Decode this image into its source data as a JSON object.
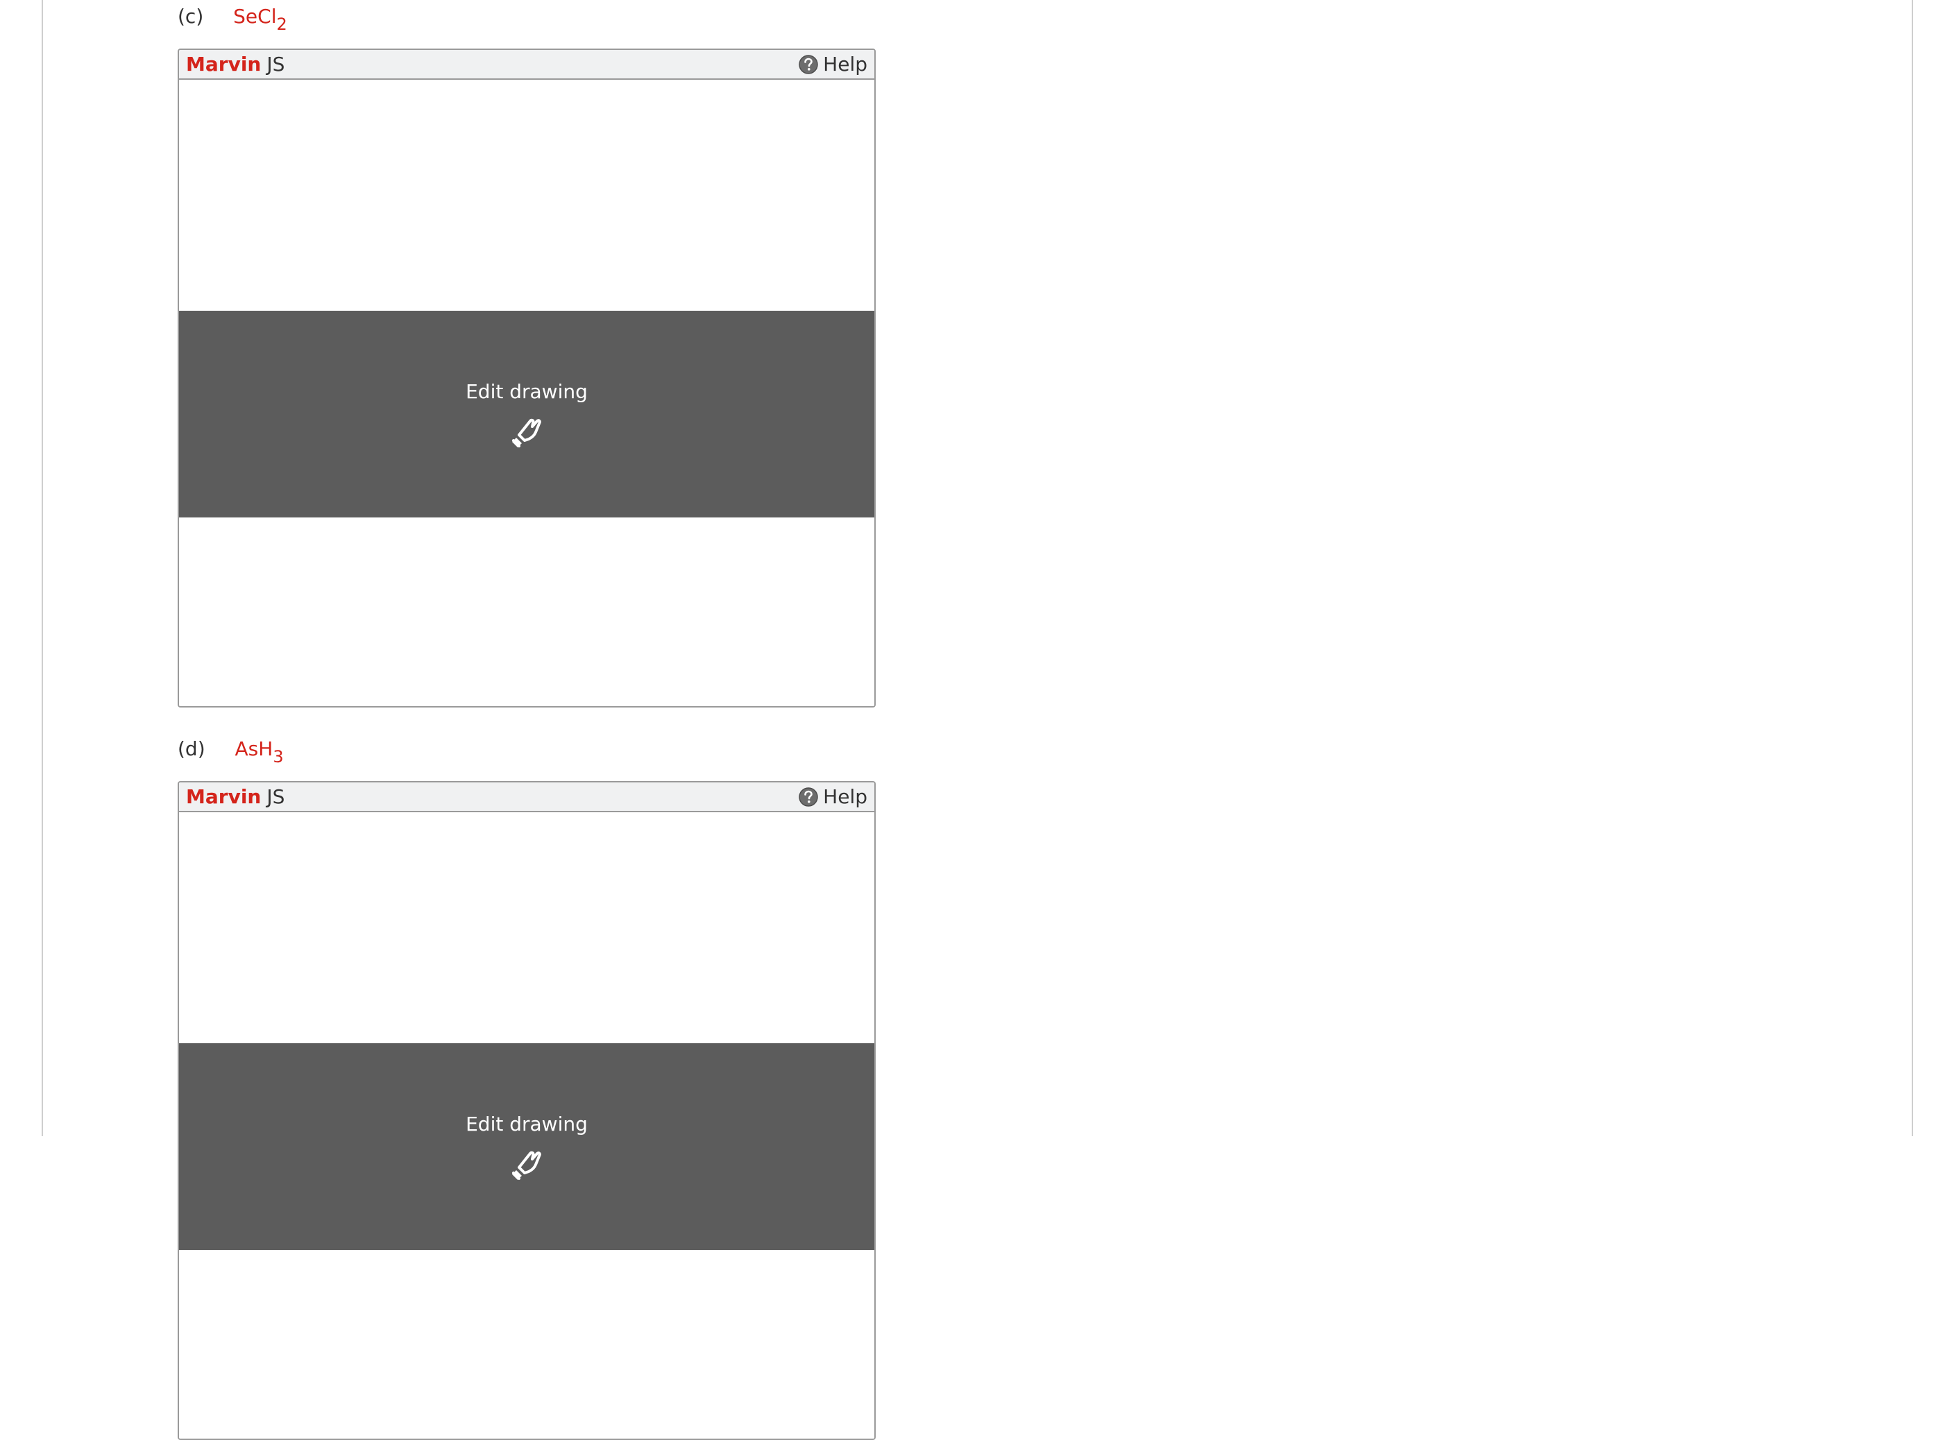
{
  "questions": [
    {
      "letter": "(c)",
      "formula_main": "SeCl",
      "formula_sub": "2",
      "editor": {
        "brand_strong": "Marvin",
        "brand_rest": "JS",
        "help_label": "Help",
        "help_icon": "help-circle-icon",
        "edit_label": "Edit drawing",
        "edit_icon": "hand-pointer-icon"
      }
    },
    {
      "letter": "(d)",
      "formula_main": "AsH",
      "formula_sub": "3",
      "editor": {
        "brand_strong": "Marvin",
        "brand_rest": "JS",
        "help_label": "Help",
        "help_icon": "help-circle-icon",
        "edit_label": "Edit drawing",
        "edit_icon": "hand-pointer-icon"
      }
    }
  ],
  "colors": {
    "accent_red": "#d4241b",
    "overlay_gray": "#5c5c5c",
    "header_bg": "#f0f1f2",
    "border_gray": "#9a9a9a"
  }
}
